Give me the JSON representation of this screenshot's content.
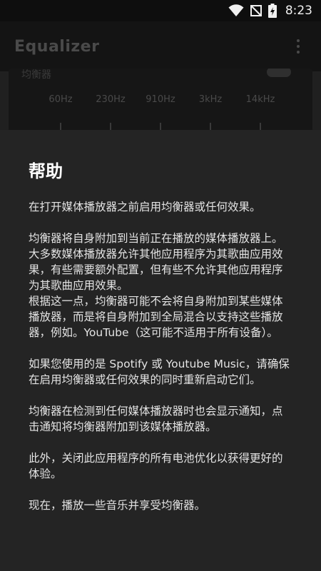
{
  "status_bar": {
    "time": "8:23",
    "icons": [
      "wifi-icon",
      "no-signal-icon",
      "battery-charging-icon"
    ]
  },
  "app_bar": {
    "title": "Equalizer",
    "menu_icon": "more-vert-icon"
  },
  "background": {
    "switch_label": "均衡器",
    "frequencies": [
      "60Hz",
      "230Hz",
      "910Hz",
      "3kHz",
      "14kHz"
    ]
  },
  "help": {
    "title": "帮助",
    "paragraphs": [
      "在打开媒体播放器之前启用均衡器或任何效果。",
      "均衡器将自身附加到当前正在播放的媒体播放器上。\n大多数媒体播放器允许其他应用程序为其歌曲应用效果，有些需要额外配置，但有些不允许其他应用程序为其歌曲应用效果。\n根据这一点，均衡器可能不会将自身附加到某些媒体播放器，而是将自身附加到全局混合以支持这些播放器，例如。YouTube（这可能不适用于所有设备）。",
      "如果您使用的是 Spotify 或 Youtube Music，请确保在启用均衡器或任何效果的同时重新启动它们。",
      "均衡器在检测到任何媒体播放器时也会显示通知，点击通知将均衡器附加到该媒体播放器。",
      "此外，关闭此应用程序的所有电池优化以获得更好的体验。",
      "现在，播放一些音乐并享受均衡器。"
    ]
  }
}
